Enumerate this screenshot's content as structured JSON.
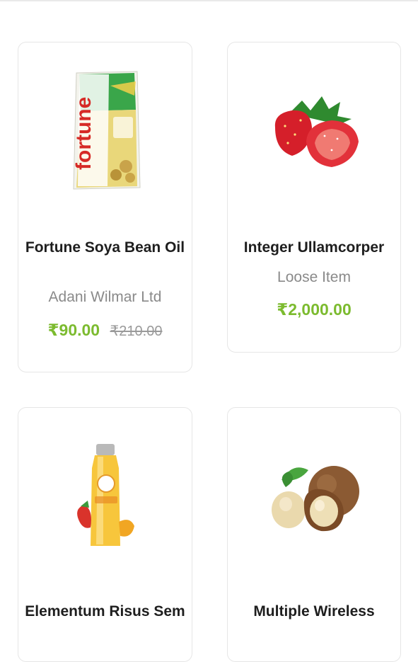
{
  "products": [
    {
      "name": "Fortune Soya Bean Oil",
      "subtitle": "Adani Wilmar Ltd",
      "price": "₹90.00",
      "old_price": "₹210.00",
      "image_icon": "oil-pouch-icon"
    },
    {
      "name": "Integer Ullamcorper",
      "subtitle": "Loose Item",
      "price": "₹2,000.00",
      "image_icon": "strawberry-icon"
    },
    {
      "name": "Elementum Risus Sem",
      "image_icon": "juice-bottle-icon"
    },
    {
      "name": "Multiple Wireless",
      "image_icon": "nuts-icon"
    }
  ],
  "logo_text": "fortune"
}
